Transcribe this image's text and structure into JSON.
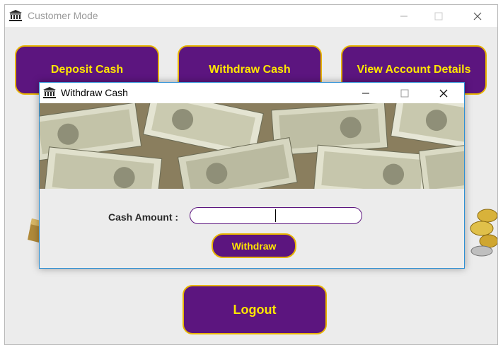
{
  "main_window": {
    "title": "Customer Mode",
    "buttons": {
      "deposit": "Deposit Cash",
      "withdraw": "Withdraw Cash",
      "view_account": "View Account Details",
      "logout": "Logout"
    }
  },
  "withdraw_dialog": {
    "title": "Withdraw Cash",
    "cash_amount_label": "Cash Amount :",
    "cash_amount_value": "",
    "withdraw_button": "Withdraw"
  },
  "colors": {
    "button_bg": "#5c157f",
    "button_text": "#ffe600",
    "button_border": "#e8b400",
    "dialog_border": "#2d8fd4"
  },
  "icons": {
    "app": "bank-icon",
    "minimize": "minimize-icon",
    "maximize": "maximize-icon",
    "close": "close-icon"
  }
}
